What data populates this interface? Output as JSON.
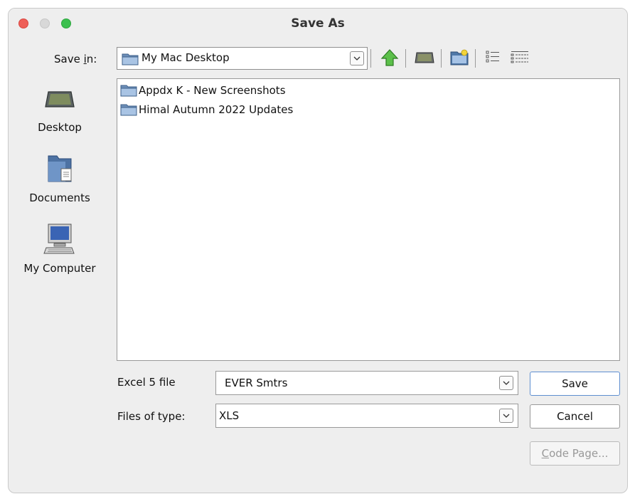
{
  "window": {
    "title": "Save As"
  },
  "save_in": {
    "label_pre": "Save ",
    "label_mnemonic": "i",
    "label_post": "n:",
    "value": "My Mac Desktop"
  },
  "toolbar": {
    "icons": [
      "up-one-level-icon",
      "desktop-icon",
      "new-folder-icon",
      "list-view-icon",
      "details-view-icon"
    ]
  },
  "places": [
    {
      "label": "Desktop",
      "icon": "desktop-drive-icon"
    },
    {
      "label": "Documents",
      "icon": "documents-folder-icon"
    },
    {
      "label": "My Computer",
      "icon": "computer-icon"
    }
  ],
  "files": [
    {
      "name": "Appdx K - New Screenshots",
      "icon": "folder-icon"
    },
    {
      "name": "Himal Autumn 2022 Updates",
      "icon": "folder-icon"
    }
  ],
  "form": {
    "filename_label": "Excel 5 file",
    "filename_value": "EVER Smtrs",
    "type_label": "Files of type:",
    "type_value": "XLS"
  },
  "buttons": {
    "save": "Save",
    "cancel": "Cancel",
    "code_page_mnemonic": "C",
    "code_page_rest": "ode Page..."
  },
  "colors": {
    "accent": "#5f8fd0",
    "close": "#ee5f58",
    "zoom": "#3cc04f"
  }
}
